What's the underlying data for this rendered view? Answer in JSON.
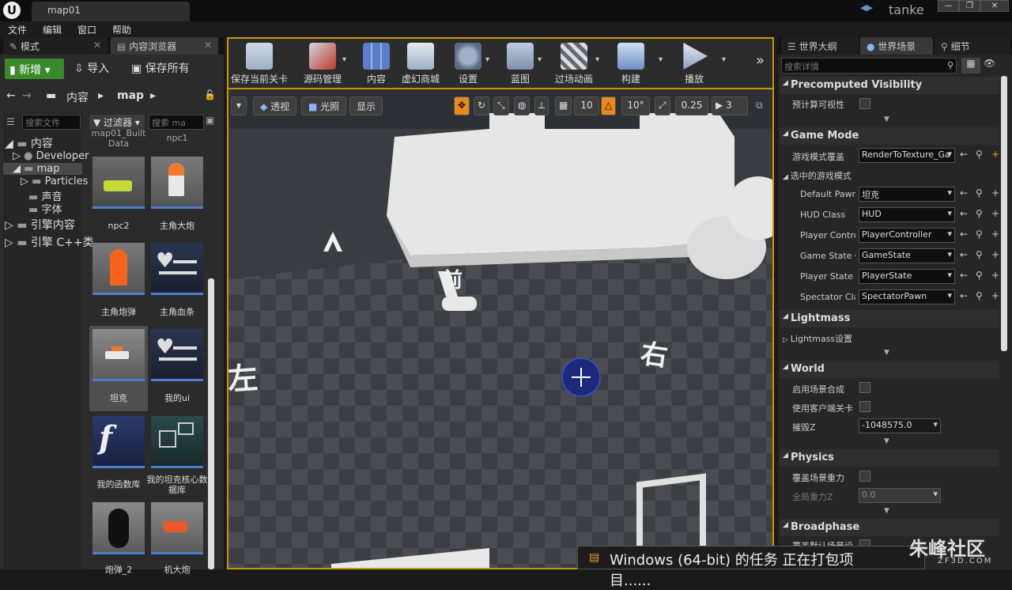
{
  "titlebar": {
    "logo": "U",
    "tab": "map01",
    "project": "tanke",
    "window_buttons": [
      "—",
      "❐",
      "✕"
    ]
  },
  "menu": [
    "文件",
    "编辑",
    "窗口",
    "帮助"
  ],
  "left_tabs": [
    "模式",
    "内容浏览器"
  ],
  "content_browser": {
    "new_label": "新增",
    "import_label": "导入",
    "save_all_label": "保存所有",
    "breadcrumb": [
      "内容",
      "map"
    ],
    "search_folders_placeholder": "搜索文件",
    "filter_label": "过滤器",
    "search_assets_placeholder": "搜索 ma",
    "tree": [
      "内容",
      "Developer",
      "map",
      "Particles",
      "声音",
      "字体",
      "引擎内容",
      "引擎 C++类"
    ],
    "assets": [
      {
        "label": "map01_Built Data"
      },
      {
        "label": "npc1"
      },
      {
        "label": "npc2"
      },
      {
        "label": "主角大炮"
      },
      {
        "label": "主角炮弹"
      },
      {
        "label": "主角血条"
      },
      {
        "label": "坦克"
      },
      {
        "label": "我的ui"
      },
      {
        "label": "我的函数库"
      },
      {
        "label": "我的坦克核心数据库"
      },
      {
        "label": "炮弹_2"
      },
      {
        "label": "机大炮"
      }
    ]
  },
  "toolbar": [
    {
      "label": "保存当前关卡",
      "icon": "save-icon"
    },
    {
      "label": "源码管理",
      "icon": "source-control-icon"
    },
    {
      "label": "内容",
      "icon": "content-icon"
    },
    {
      "label": "虚幻商城",
      "icon": "marketplace-icon"
    },
    {
      "label": "设置",
      "icon": "settings-icon"
    },
    {
      "label": "蓝图",
      "icon": "blueprint-icon"
    },
    {
      "label": "过场动画",
      "icon": "cinematics-icon"
    },
    {
      "label": "构建",
      "icon": "build-icon"
    },
    {
      "label": "播放",
      "icon": "play-icon"
    }
  ],
  "viewport": {
    "perspective_label": "透视",
    "lighting_label": "光照",
    "show_label": "显示",
    "grid_snap": "10",
    "rotation_snap": "10°",
    "scale_snap": "0.25",
    "camera_speed": "3",
    "floor_labels": [
      "前",
      "右",
      "左"
    ]
  },
  "right_tabs": [
    "世界大纲",
    "世界场景",
    "细节"
  ],
  "details": {
    "search_placeholder": "搜索详情",
    "sections": {
      "precomputed": "Precomputed Visibility",
      "gamemode": "Game Mode",
      "lightmass": "Lightmass",
      "world": "World",
      "physics": "Physics",
      "broadphase": "Broadphase"
    },
    "precomputed_visibility_label": "预计算可视性",
    "game_mode_override_label": "游戏模式覆盖",
    "game_mode_override_value": "RenderToTexture_Ga",
    "selected_game_mode_label": "选中的游戏模式",
    "gamemode_rows": [
      {
        "label": "Default Pawn",
        "value": "坦克"
      },
      {
        "label": "HUD Class",
        "value": "HUD"
      },
      {
        "label": "Player Contro",
        "value": "PlayerController"
      },
      {
        "label": "Game State C",
        "value": "GameState"
      },
      {
        "label": "Player State (",
        "value": "PlayerState"
      },
      {
        "label": "Spectator Cla",
        "value": "SpectatorPawn"
      }
    ],
    "lightmass_settings_label": "Lightmass设置",
    "world_rows": [
      {
        "label": "启用场景合成"
      },
      {
        "label": "使用客户端关卡"
      }
    ],
    "kill_z_label": "摧毁Z",
    "kill_z_value": "-1048575.0",
    "override_gravity_label": "覆盖场景重力",
    "global_gravity_label": "全局重力Z",
    "global_gravity_value": "0.0",
    "broadphase_row_label": "覆盖默认场景设"
  },
  "notification": "Windows (64-bit) 的任务 正在打包项目......",
  "watermark": {
    "brand": "朱峰社区",
    "url": "ZF3D.COM"
  },
  "colors": {
    "accent": "#c49a00",
    "new_button": "#3a8a2c",
    "selection": "#4a7fd0"
  }
}
